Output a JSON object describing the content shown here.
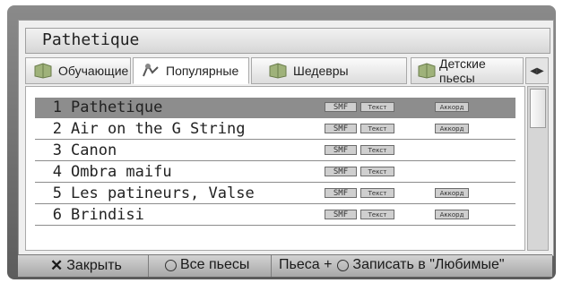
{
  "title": "Pathetique",
  "tabs": [
    {
      "label": "Обучающие",
      "icon": "book-icon"
    },
    {
      "label": "Популярные",
      "icon": "popular-icon"
    },
    {
      "label": "Шедевры",
      "icon": "book-icon"
    },
    {
      "label": "Детские пьесы",
      "icon": "book-icon"
    }
  ],
  "tab_arrows": "◀▶",
  "badges": {
    "smf": "SMF",
    "text": "Текст",
    "chord": "Аккорд"
  },
  "songs": [
    {
      "num": "1",
      "name": "Pathetique",
      "chord": true,
      "selected": true
    },
    {
      "num": "2",
      "name": "Air on the G String",
      "chord": true
    },
    {
      "num": "3",
      "name": "Canon",
      "chord": false
    },
    {
      "num": "4",
      "name": "Ombra maifu",
      "chord": false
    },
    {
      "num": "5",
      "name": "Les patineurs, Valse",
      "chord": true
    },
    {
      "num": "6",
      "name": "Brindisi",
      "chord": true
    }
  ],
  "bottom": {
    "close_icon": "✕",
    "close": "Закрыть",
    "all_pieces": "Все пьесы",
    "piece_plus": "Пьеса +",
    "save_fav": "Записать в \"Любимые\""
  },
  "colors": {
    "selected_row": "#8d8d8d",
    "frame": "#6e6e6e"
  }
}
